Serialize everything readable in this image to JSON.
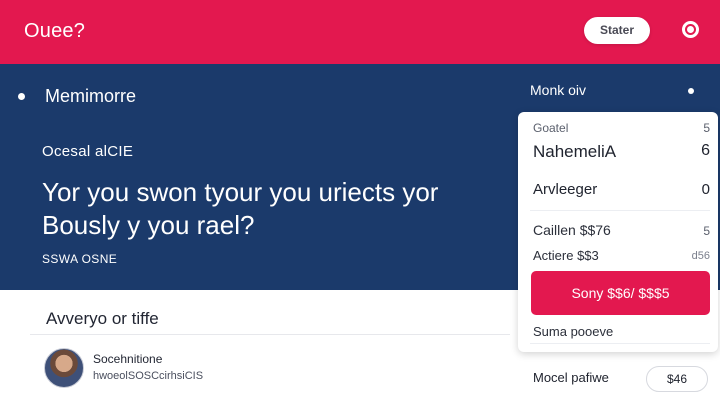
{
  "header": {
    "brand": "Ouee?",
    "button_label": "Stater",
    "icon": "target-icon"
  },
  "hero": {
    "title": "Memimorre",
    "subtitle": "Ocesal alCIE",
    "headline": "Yor you swon tyour you uriects yor Bously y you rael?",
    "small_text": "SSWA OSNE"
  },
  "section": {
    "title": "Avveryo or tiffe",
    "person_name": "Socehnitione",
    "person_meta": "hwoeolSOSCcirhsiCIS"
  },
  "side_panel": {
    "header": "Monk oiv",
    "rows": [
      {
        "label": "Goatel",
        "value": "5"
      },
      {
        "label": "NahemeliA",
        "value": "6"
      },
      {
        "label": "Arvleeger",
        "value": "0"
      },
      {
        "label": "Caillen $$76",
        "value": "5"
      },
      {
        "label": "Actiere $$3",
        "value": "d56"
      }
    ],
    "cta_label": "Sony $$6/ $$$5",
    "secondary_label": "Suma pooeve",
    "bottom_label": "Mocel pafiwe",
    "bottom_value": "$46"
  },
  "colors": {
    "brand_red": "#e3184f",
    "hero_navy": "#1b3a6b"
  }
}
